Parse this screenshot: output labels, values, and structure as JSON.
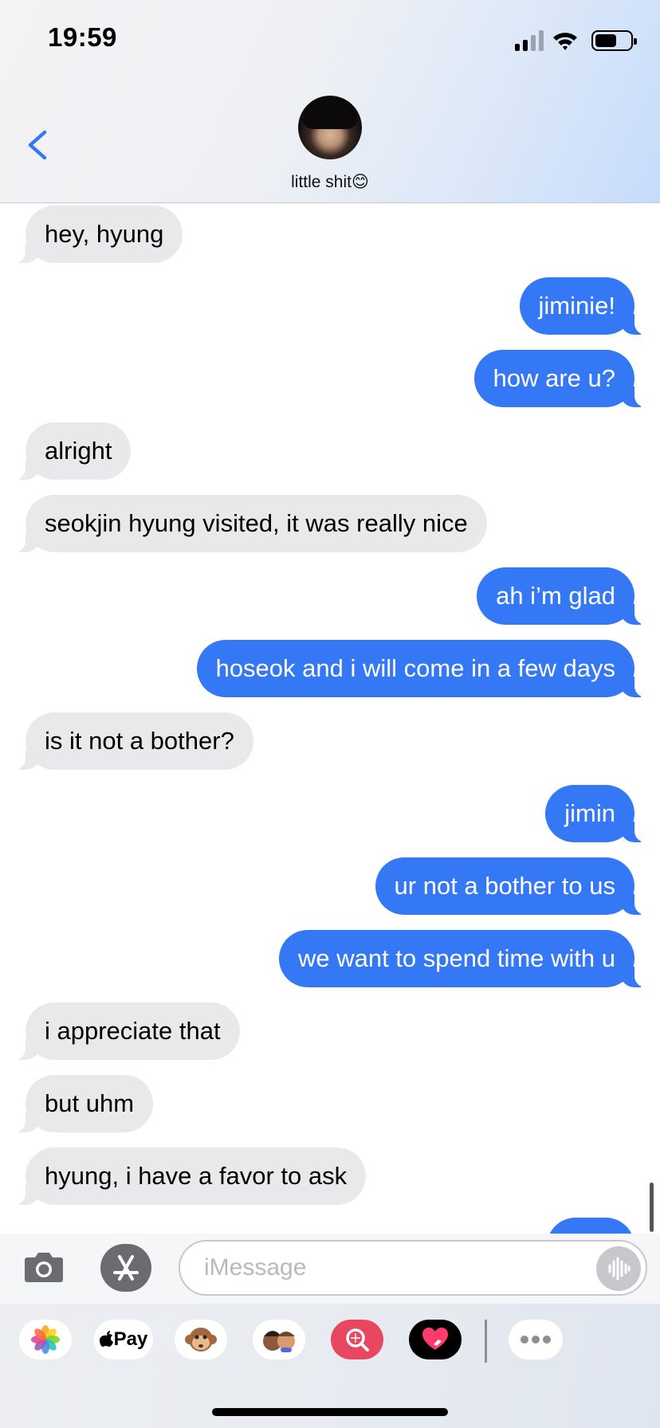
{
  "status_bar": {
    "time": "19:59"
  },
  "header": {
    "contact_name": "little shit😊"
  },
  "messages": [
    {
      "text": "hey, hyung",
      "side": "in"
    },
    {
      "text": "jiminie!",
      "side": "out"
    },
    {
      "text": "how are u?",
      "side": "out"
    },
    {
      "text": "alright",
      "side": "in"
    },
    {
      "text": "seokjin hyung visited, it was really nice",
      "side": "in"
    },
    {
      "text": "ah i’m glad",
      "side": "out"
    },
    {
      "text": "hoseok and i will come in a few days",
      "side": "out"
    },
    {
      "text": "is it not a bother?",
      "side": "in"
    },
    {
      "text": "jimin",
      "side": "out"
    },
    {
      "text": "ur not a bother to us",
      "side": "out"
    },
    {
      "text": "we want to spend time with u",
      "side": "out"
    },
    {
      "text": "i appreciate that",
      "side": "in"
    },
    {
      "text": "but uhm",
      "side": "in"
    },
    {
      "text": "hyung, i have a favor to ask",
      "side": "in"
    }
  ],
  "input": {
    "placeholder": "iMessage"
  },
  "drawer": {
    "apple_pay_label": "Pay"
  },
  "colors": {
    "outgoing_bubble": "#3478f6",
    "incoming_bubble": "#e9e9eb",
    "accent": "#3478f6"
  },
  "icons": [
    "back-chevron-icon",
    "signal-icon",
    "wifi-icon",
    "battery-icon",
    "camera-icon",
    "app-store-icon",
    "audio-waveform-icon",
    "photos-icon",
    "apple-icon",
    "monkey-icon",
    "memoji-icon",
    "search-images-icon",
    "digital-touch-icon",
    "more-icon"
  ]
}
